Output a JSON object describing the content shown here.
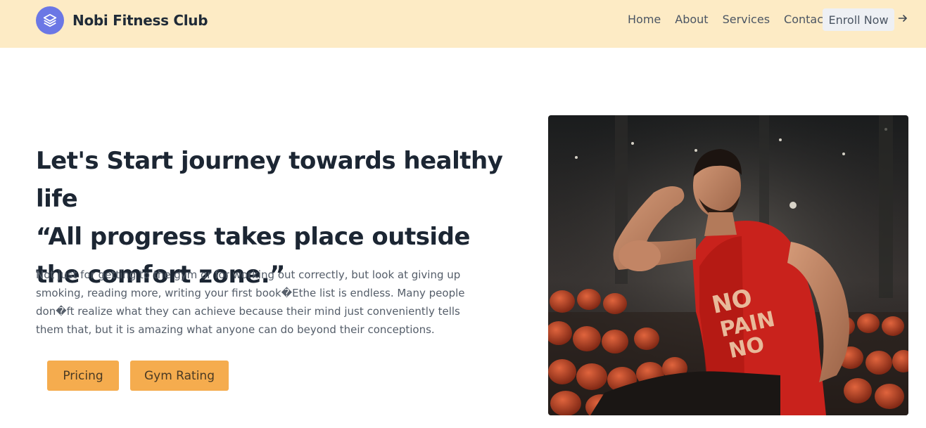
{
  "brand": {
    "name": "Nobi Fitness Club",
    "logo_icon": "layers-icon",
    "logo_color": "#6b77e5"
  },
  "nav": {
    "links": [
      "Home",
      "About",
      "Services",
      "Contact"
    ],
    "cta_label": "Enroll Now",
    "cta_icon": "arrow-right-icon"
  },
  "hero": {
    "headline_line1": "Let's Start journey towards healthy life",
    "headline_line2": "“All progress takes place outside the comfort zone.”",
    "description": "Not just for getting to the gym or for working out correctly, but look at giving up smoking, reading more, writing your first book�Ethe list is endless. Many people don�ft realize what they can achieve because their mind just conveniently tells them that, but it is amazing what anyone can do beyond their conceptions.",
    "buttons": [
      "Pricing",
      "Gym Rating"
    ],
    "image_text": "NO PAIN NO"
  },
  "colors": {
    "navbar_bg": "#fdebc5",
    "button_bg": "#f5ac4e",
    "accent": "#6b77e5"
  }
}
